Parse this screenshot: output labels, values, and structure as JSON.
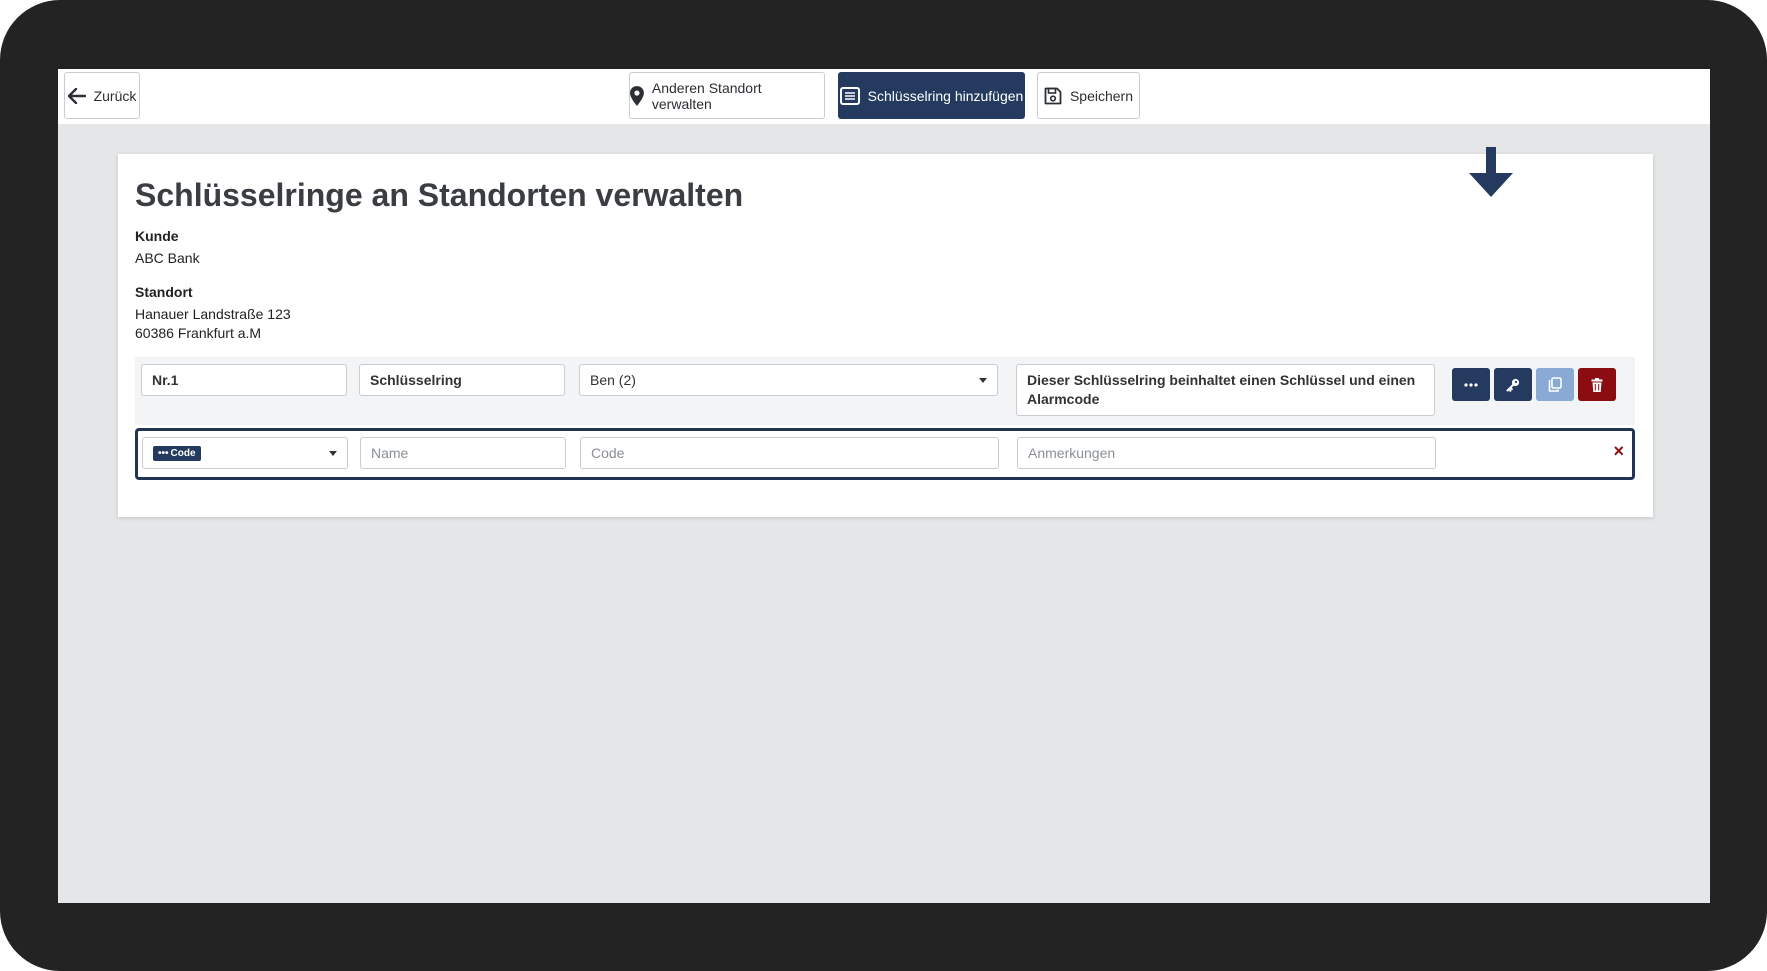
{
  "toolbar": {
    "back_label": "Zurück",
    "other_location_label": "Anderen Standort verwalten",
    "add_keyring_label": "Schlüsselring hinzufügen",
    "save_label": "Speichern"
  },
  "page": {
    "title": "Schlüsselringe an Standorten verwalten",
    "customer_label": "Kunde",
    "customer_value": "ABC Bank",
    "location_label": "Standort",
    "location_line1": "Hanauer Landstraße 123",
    "location_line2": "60386 Frankfurt a.M"
  },
  "keyring_row": {
    "number": "Nr.1",
    "type": "Schlüsselring",
    "person": "Ben (2)",
    "note_line1": "Dieser Schlüsselring beinhaltet einen Schlüssel und einen",
    "note_line2": "Alarmcode"
  },
  "code_row": {
    "type_badge": "Code",
    "name_placeholder": "Name",
    "code_placeholder": "Code",
    "notes_placeholder": "Anmerkungen",
    "close_symbol": "×"
  },
  "colors": {
    "primary": "#243b5f",
    "light_blue": "#8aaad6",
    "danger": "#8b0d12",
    "frame": "#232323",
    "background": "#e5e6e8"
  },
  "icons": [
    "arrow-left-icon",
    "location-pin-icon",
    "list-icon",
    "floppy-disk-icon",
    "ellipsis-icon",
    "key-icon",
    "copy-icon",
    "trash-icon",
    "chevron-down-icon",
    "close-icon",
    "down-arrow-indicator-icon"
  ]
}
